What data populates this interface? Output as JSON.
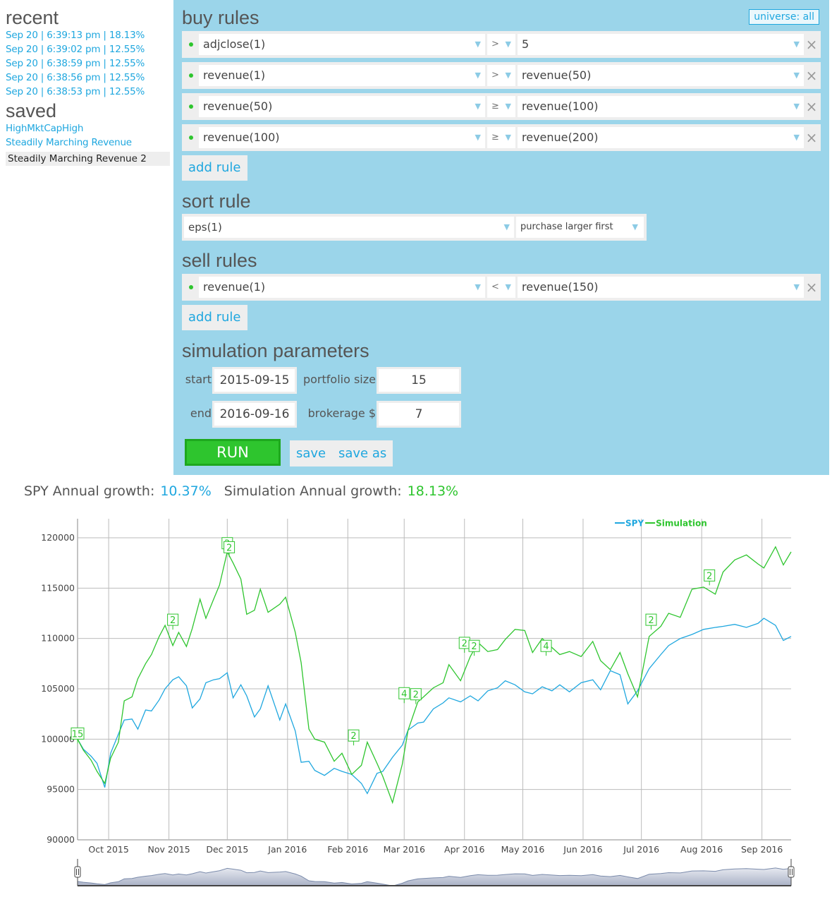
{
  "sidebar": {
    "recent_title": "recent",
    "recent": [
      "Sep 20 | 6:39:13 pm | 18.13%",
      "Sep 20 | 6:39:02 pm | 12.55%",
      "Sep 20 | 6:38:59 pm | 12.55%",
      "Sep 20 | 6:38:56 pm | 12.55%",
      "Sep 20 | 6:38:53 pm | 12.55%"
    ],
    "saved_title": "saved",
    "saved": [
      "HighMktCapHigh",
      "Steadily Marching Revenue"
    ],
    "saved_selected": "Steadily Marching Revenue 2"
  },
  "buy": {
    "title": "buy rules",
    "universe": "universe: all",
    "rules": [
      {
        "left": "adjclose(1)",
        "op": ">",
        "right": "5"
      },
      {
        "left": "revenue(1)",
        "op": ">",
        "right": "revenue(50)"
      },
      {
        "left": "revenue(50)",
        "op": "≥",
        "right": "revenue(100)"
      },
      {
        "left": "revenue(100)",
        "op": "≥",
        "right": "revenue(200)"
      }
    ],
    "add_rule": "add rule"
  },
  "sort": {
    "title": "sort rule",
    "field": "eps(1)",
    "order": "purchase larger first"
  },
  "sell": {
    "title": "sell rules",
    "rules": [
      {
        "left": "revenue(1)",
        "op": "<",
        "right": "revenue(150)"
      }
    ],
    "add_rule": "add rule"
  },
  "sim": {
    "title": "simulation parameters",
    "start_label": "start",
    "start": "2015-09-15",
    "end_label": "end",
    "end": "2016-09-16",
    "portfolio_label": "portfolio size",
    "portfolio": "15",
    "brokerage_label": "brokerage $",
    "brokerage": "7",
    "run": "RUN",
    "save": "save",
    "save_as": "save as"
  },
  "growth": {
    "spy_label": "SPY Annual growth:",
    "spy_value": "10.37%",
    "sim_label": "Simulation Annual growth:",
    "sim_value": "18.13%"
  },
  "colors": {
    "spy": "#1fa7df",
    "simulation": "#2ec52e",
    "panel": "#9bd5ea"
  },
  "chart_data": {
    "type": "line",
    "title": "",
    "xlabel": "",
    "ylabel": "",
    "ylim": [
      90000,
      120000
    ],
    "xlim": [
      "2015-09-15",
      "2016-09-16"
    ],
    "yticks": [
      90000,
      95000,
      100000,
      105000,
      110000,
      115000,
      120000
    ],
    "xticks": [
      "Oct 2015",
      "Nov 2015",
      "Dec 2015",
      "Jan 2016",
      "Feb 2016",
      "Mar 2016",
      "Apr 2016",
      "May 2016",
      "Jun 2016",
      "Jul 2016",
      "Aug 2016",
      "Sep 2016"
    ],
    "xtick_dates": [
      "2015-10-01",
      "2015-11-01",
      "2015-12-01",
      "2016-01-01",
      "2016-02-01",
      "2016-03-01",
      "2016-04-01",
      "2016-05-01",
      "2016-06-01",
      "2016-07-01",
      "2016-08-01",
      "2016-09-01"
    ],
    "grid": true,
    "legend": {
      "position": "top-right",
      "entries": [
        "SPY",
        "Simulation"
      ]
    },
    "x": [
      "2015-09-15",
      "2015-09-18",
      "2015-09-22",
      "2015-09-25",
      "2015-09-29",
      "2015-10-02",
      "2015-10-06",
      "2015-10-09",
      "2015-10-13",
      "2015-10-16",
      "2015-10-20",
      "2015-10-23",
      "2015-10-27",
      "2015-10-30",
      "2015-11-03",
      "2015-11-06",
      "2015-11-10",
      "2015-11-13",
      "2015-11-17",
      "2015-11-20",
      "2015-11-24",
      "2015-11-27",
      "2015-12-01",
      "2015-12-04",
      "2015-12-08",
      "2015-12-11",
      "2015-12-15",
      "2015-12-18",
      "2015-12-22",
      "2015-12-28",
      "2015-12-31",
      "2016-01-05",
      "2016-01-08",
      "2016-01-12",
      "2016-01-15",
      "2016-01-20",
      "2016-01-25",
      "2016-01-29",
      "2016-02-03",
      "2016-02-08",
      "2016-02-11",
      "2016-02-16",
      "2016-02-19",
      "2016-02-24",
      "2016-02-29",
      "2016-03-03",
      "2016-03-08",
      "2016-03-11",
      "2016-03-16",
      "2016-03-21",
      "2016-03-24",
      "2016-03-30",
      "2016-04-04",
      "2016-04-08",
      "2016-04-13",
      "2016-04-18",
      "2016-04-22",
      "2016-04-27",
      "2016-05-02",
      "2016-05-06",
      "2016-05-11",
      "2016-05-16",
      "2016-05-20",
      "2016-05-25",
      "2016-05-31",
      "2016-06-06",
      "2016-06-10",
      "2016-06-15",
      "2016-06-20",
      "2016-06-24",
      "2016-06-29",
      "2016-07-05",
      "2016-07-11",
      "2016-07-15",
      "2016-07-21",
      "2016-07-27",
      "2016-08-02",
      "2016-08-08",
      "2016-08-12",
      "2016-08-18",
      "2016-08-24",
      "2016-08-30",
      "2016-09-02",
      "2016-09-08",
      "2016-09-12",
      "2016-09-16"
    ],
    "series": [
      {
        "name": "SPY",
        "color": "#1fa7df",
        "values": [
          100000,
          99000,
          98300,
          97600,
          95200,
          98600,
          100500,
          101900,
          102000,
          101000,
          102900,
          102800,
          103900,
          105000,
          105900,
          106200,
          105300,
          103100,
          104000,
          105600,
          105900,
          106000,
          106600,
          104100,
          105400,
          104300,
          102200,
          103000,
          105300,
          101900,
          103500,
          100800,
          97700,
          97800,
          96900,
          96400,
          97100,
          96800,
          96500,
          95600,
          94600,
          96600,
          96800,
          98200,
          99400,
          100900,
          101600,
          101700,
          103000,
          103600,
          104100,
          103700,
          104300,
          103800,
          104800,
          105100,
          105800,
          105400,
          104700,
          104500,
          105200,
          104800,
          105400,
          104700,
          105600,
          105900,
          104900,
          106800,
          106400,
          103500,
          104800,
          107000,
          108400,
          109300,
          110000,
          110400,
          110900,
          111100,
          111200,
          111400,
          111100,
          111500,
          112000,
          111300,
          109800,
          110200
        ]
      },
      {
        "name": "Simulation",
        "color": "#2ec52e",
        "values": [
          100000,
          98900,
          97900,
          96800,
          95600,
          98100,
          99700,
          103800,
          104200,
          106000,
          107500,
          108400,
          110200,
          111300,
          109300,
          110600,
          109200,
          111000,
          113900,
          112000,
          113900,
          115300,
          118600,
          117500,
          115900,
          112400,
          112800,
          114900,
          112600,
          113400,
          114100,
          110600,
          107600,
          101000,
          100000,
          99700,
          97800,
          98600,
          96500,
          97400,
          99700,
          97600,
          96300,
          93700,
          97500,
          100900,
          103700,
          104200,
          105100,
          105600,
          107400,
          105800,
          108200,
          109600,
          108700,
          108900,
          109900,
          110900,
          110800,
          108600,
          110000,
          109100,
          108400,
          108700,
          108200,
          109700,
          107800,
          106900,
          108600,
          106500,
          104200,
          110200,
          111200,
          112500,
          112100,
          114900,
          115100,
          114400,
          116600,
          117800,
          118300,
          117400,
          117000,
          119100,
          117300,
          118600
        ]
      }
    ],
    "trade_markers": [
      {
        "date": "2015-09-15",
        "label": "15",
        "value": 100000
      },
      {
        "date": "2015-11-03",
        "label": "2",
        "value": 111300
      },
      {
        "date": "2015-12-01",
        "label": "2",
        "value": 118900
      },
      {
        "date": "2015-12-02",
        "label": "2",
        "value": 118500
      },
      {
        "date": "2016-02-04",
        "label": "2",
        "value": 99800
      },
      {
        "date": "2016-03-01",
        "label": "4",
        "value": 104000
      },
      {
        "date": "2016-03-07",
        "label": "2",
        "value": 103900
      },
      {
        "date": "2016-04-01",
        "label": "2",
        "value": 109000
      },
      {
        "date": "2016-04-06",
        "label": "2",
        "value": 108700
      },
      {
        "date": "2016-05-13",
        "label": "4",
        "value": 108700
      },
      {
        "date": "2016-07-06",
        "label": "2",
        "value": 111300
      },
      {
        "date": "2016-08-05",
        "label": "2",
        "value": 115700
      }
    ]
  }
}
